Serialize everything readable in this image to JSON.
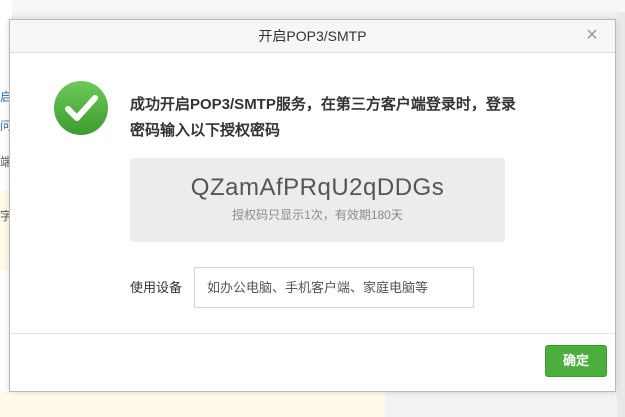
{
  "background": {
    "left_chars": [
      "启",
      "问",
      "端",
      "字"
    ]
  },
  "modal": {
    "title": "开启POP3/SMTP",
    "close_glyph": "×",
    "success_message": "成功开启POP3/SMTP服务，在第三方客户端登录时，登录密码输入以下授权密码",
    "auth_code": "QZamAfPRqU2qDDGs",
    "auth_note": "授权码只显示1次，有效期180天",
    "device_label": "使用设备",
    "device_placeholder": "如办公电脑、手机客户端、家庭电脑等",
    "confirm_label": "确定"
  },
  "colors": {
    "accent_green": "#4cae3c",
    "code_box_bg": "#ececec"
  }
}
